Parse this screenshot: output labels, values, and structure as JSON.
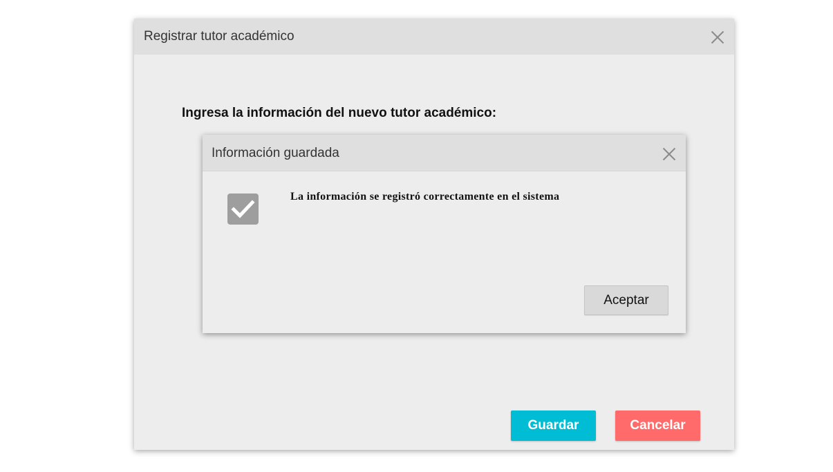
{
  "main_dialog": {
    "title": "Registrar tutor académico",
    "instruction": "Ingresa la información del nuevo tutor académico:",
    "buttons": {
      "save_label": "Guardar",
      "cancel_label": "Cancelar"
    },
    "close_icon": "close-icon"
  },
  "info_dialog": {
    "title": "Información guardada",
    "message": "La información se registró correctamente en el sistema",
    "accept_label": "Aceptar",
    "status_icon": "checkbox-checked-icon",
    "close_icon": "close-icon"
  },
  "colors": {
    "save_button": "#00bcd4",
    "cancel_button": "#ff6b6b",
    "header_bg": "#dfdfdf",
    "dialog_bg": "#ededed",
    "check_icon_bg": "#9e9e9e"
  }
}
